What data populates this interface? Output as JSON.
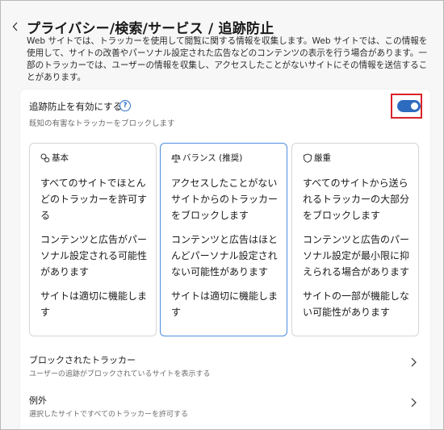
{
  "header": {
    "title": "プライバシー/検索/サービス / 追跡防止",
    "description": "Web サイトでは、トラッカーを使用して閲覧に関する情報を収集します。Web サイトでは、この情報を使用して、サイトの改善やパーソナル設定された広告などのコンテンツの表示を行う場合があります。一部のトラッカーでは、ユーザーの情報を収集し、アクセスしたことがないサイトにその情報を送信することがあります。"
  },
  "tracking_prevention": {
    "label": "追跡防止を有効にする",
    "help_glyph": "?",
    "sublabel": "既知の有害なトラッカーをブロックします",
    "enabled": true
  },
  "levels": [
    {
      "name": "基本",
      "icon": "nodes-icon",
      "selected": false,
      "points": [
        "すべてのサイトでほとんどのトラッカーを許可する",
        "コンテンツと広告がパーソナル設定される可能性があります",
        "サイトは適切に機能します"
      ]
    },
    {
      "name": "バランス (推奨)",
      "icon": "scale-icon",
      "selected": true,
      "points": [
        "アクセスしたことがないサイトからのトラッカーをブロックします",
        "コンテンツと広告はほとんどパーソナル設定されない可能性があります",
        "サイトは適切に機能します"
      ]
    },
    {
      "name": "厳重",
      "icon": "shield-icon",
      "selected": false,
      "points": [
        "すべてのサイトから送られるトラッカーの大部分をブロックします",
        "コンテンツと広告のパーソナル設定が最小限に抑えられる場合があります",
        "サイトの一部が機能しない可能性があります"
      ]
    }
  ],
  "rows": [
    {
      "title": "ブロックされたトラッカー",
      "subtitle": "ユーザーの追跡がブロックされているサイトを表示する"
    },
    {
      "title": "例外",
      "subtitle": "選択したサイトですべてのトラッカーを許可する"
    }
  ],
  "colors": {
    "accent": "#2d6bbf",
    "selected_border": "#4f8ee0",
    "highlight": "#d9232a"
  }
}
